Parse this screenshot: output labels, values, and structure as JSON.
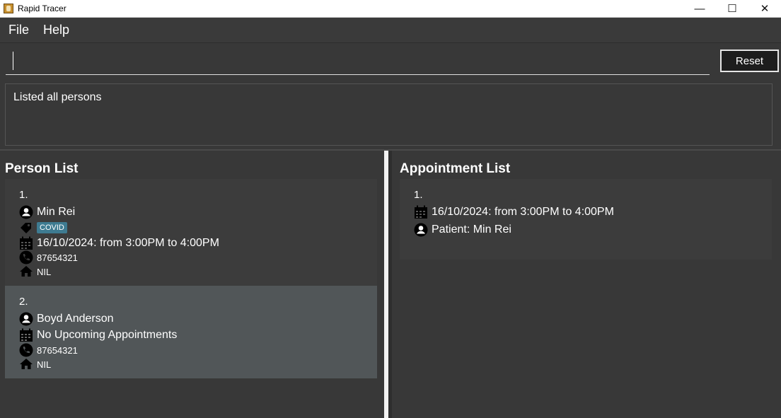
{
  "window": {
    "title": "Rapid Tracer",
    "controls": [
      "—",
      "☐",
      "✕"
    ]
  },
  "menu": {
    "file": "File",
    "help": "Help"
  },
  "command": {
    "value": "",
    "reset_label": "Reset"
  },
  "result": {
    "message": "Listed all persons"
  },
  "person_list": {
    "title": "Person List",
    "persons": [
      {
        "index": "1.",
        "name": "Min Rei",
        "tag": "COVID",
        "appointment": "16/10/2024: from 3:00PM to 4:00PM",
        "phone": "87654321",
        "address": "NIL"
      },
      {
        "index": "2.",
        "name": "Boyd Anderson",
        "appointment": "No Upcoming Appointments",
        "phone": "87654321",
        "address": "NIL"
      }
    ]
  },
  "appointment_list": {
    "title": "Appointment List",
    "appointments": [
      {
        "index": "1.",
        "time": "16/10/2024: from 3:00PM to 4:00PM",
        "patient": "Patient: Min Rei"
      }
    ]
  },
  "colors": {
    "background": "#383838",
    "card_odd": "#3c3c3c",
    "card_selected": "#515658",
    "tag": "#3e7b91"
  }
}
